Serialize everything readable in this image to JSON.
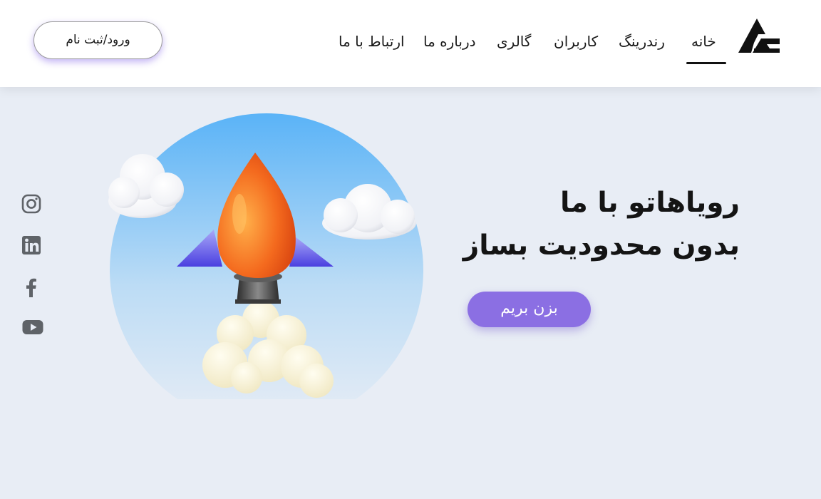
{
  "header": {
    "logo_icon": "ar-logo-icon",
    "nav": [
      {
        "label": "خانه",
        "active": true
      },
      {
        "label": "رندرینگ",
        "active": false
      },
      {
        "label": "کاربران",
        "active": false
      },
      {
        "label": "گالری",
        "active": false
      },
      {
        "label": "درباره ما",
        "active": false
      },
      {
        "label": "ارتباط با ما",
        "active": false
      }
    ],
    "login_label": "ورود/ثبت نام",
    "accent_color": "#7c5ce6"
  },
  "hero": {
    "title_line1": "رویاهاتو با ما",
    "title_line2": "بدون محدودیت بساز",
    "cta_label": "بزن بریم",
    "cta_color": "#8b6fe3",
    "illustration": "rocket-launch-illustration"
  },
  "social": [
    {
      "icon": "instagram-icon"
    },
    {
      "icon": "linkedin-icon"
    },
    {
      "icon": "facebook-icon"
    },
    {
      "icon": "youtube-icon"
    }
  ]
}
